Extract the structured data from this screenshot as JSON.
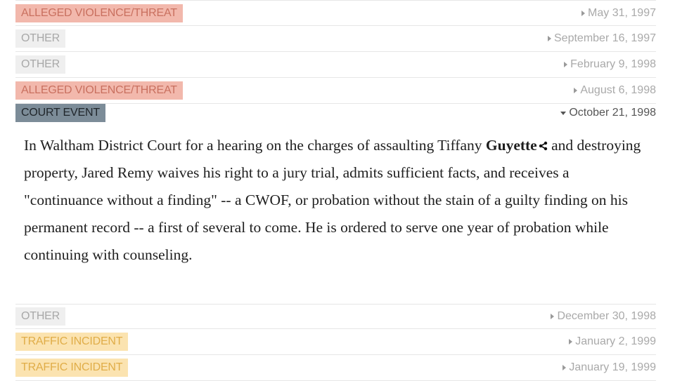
{
  "events_before": [
    {
      "tag": "ALLEGED VIOLENCE/THREAT",
      "date": "May 31, 1997"
    },
    {
      "tag": "OTHER",
      "date": "September 16, 1997"
    },
    {
      "tag": "OTHER",
      "date": "February 9, 1998"
    },
    {
      "tag": "ALLEGED VIOLENCE/THREAT",
      "date": "August 6, 1998"
    }
  ],
  "expanded_event": {
    "tag": "COURT EVENT",
    "date": "October 21, 1998",
    "text_before_name": "In Waltham District Court for a hearing on the charges of assaulting Tiffany ",
    "name": "Guyette",
    "text_after_name": " and destroying property, Jared Remy waives his right to a jury trial, admits sufficient facts, and receives a \"continuance without a finding\" -- a CWOF, or probation without the stain of a guilty finding on his permanent record -- a first of several to come. He is ordered to serve one year of probation while continuing with counseling."
  },
  "events_after": [
    {
      "tag": "OTHER",
      "date": "December 30, 1998"
    },
    {
      "tag": "TRAFFIC INCIDENT",
      "date": "January 2, 1999"
    },
    {
      "tag": "TRAFFIC INCIDENT",
      "date": "January 19, 1999"
    }
  ],
  "colors": {
    "violence": "#f2b8ac",
    "other": "#efefef",
    "court": "#7c8c98",
    "traffic": "#fbe3b0"
  }
}
